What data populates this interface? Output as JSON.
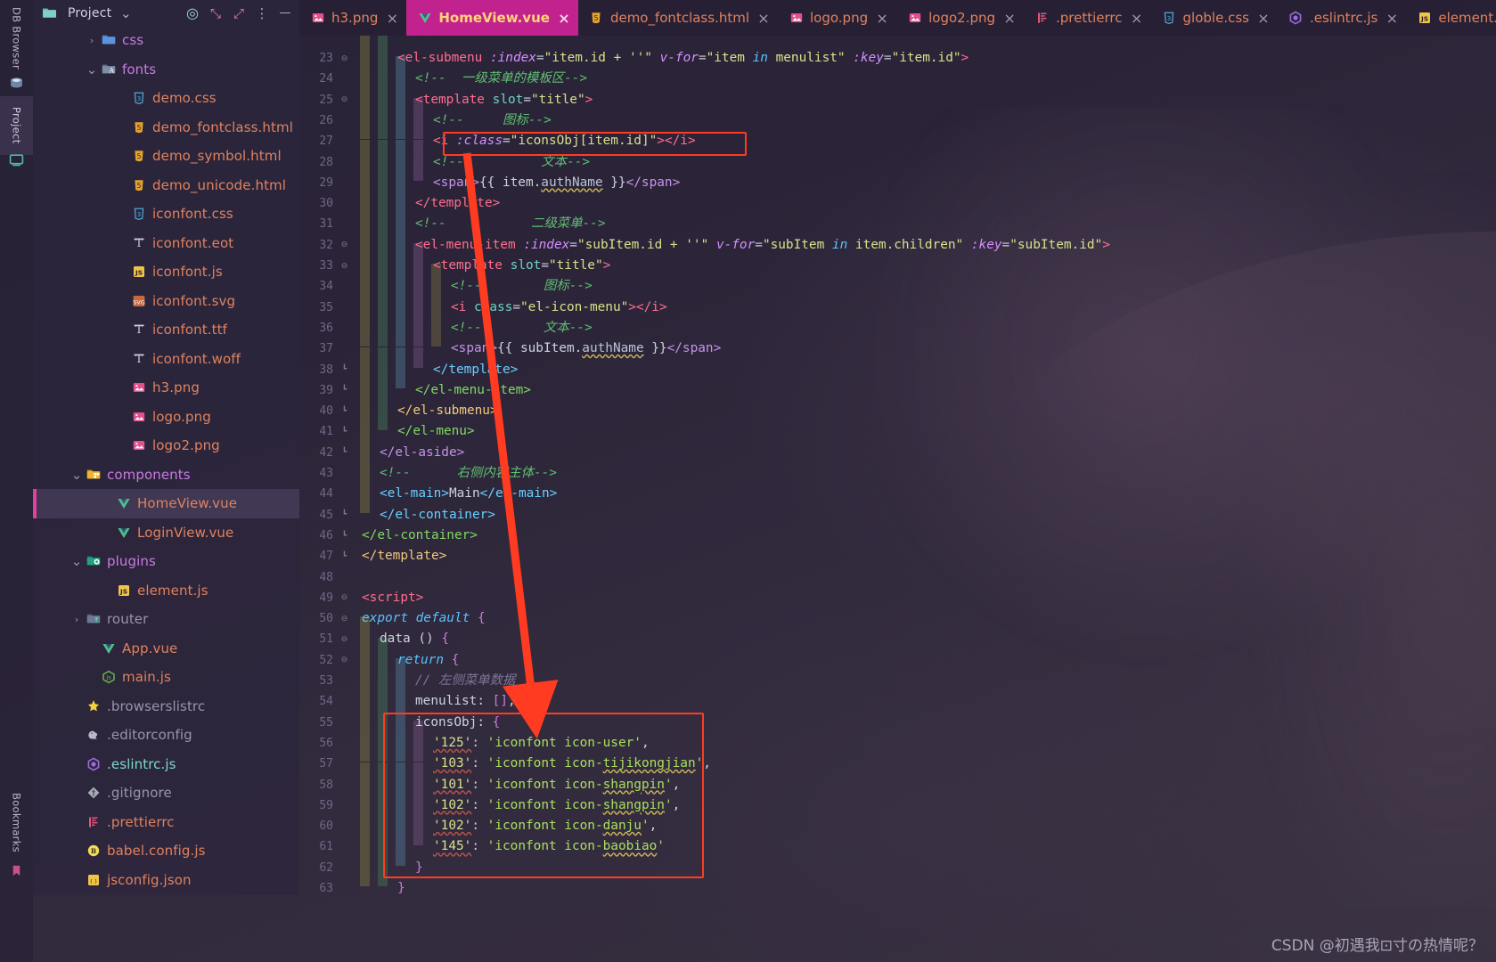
{
  "window": {
    "left_rail": [
      {
        "label": "DB Browser",
        "icon": "database-icon"
      },
      {
        "label": "Project",
        "icon": "project-icon"
      },
      {
        "label": "Bookmarks",
        "icon": "bookmark-icon"
      }
    ]
  },
  "project_pane": {
    "title": "Project",
    "header_buttons": [
      {
        "name": "chevron-down-icon",
        "glyph": "⌄"
      },
      {
        "name": "target-locate-icon",
        "glyph": "◎"
      },
      {
        "name": "expand-all-icon",
        "glyph": "⤡"
      },
      {
        "name": "collapse-all-icon",
        "glyph": "⤢"
      },
      {
        "name": "more-options-icon",
        "glyph": "⋮"
      },
      {
        "name": "minimize-icon",
        "glyph": "—"
      }
    ],
    "tree": [
      {
        "label": "css",
        "indent": 3,
        "chevron": "right",
        "icon": "folder-css",
        "color": "#c77ce0",
        "selected": false
      },
      {
        "label": "fonts",
        "indent": 3,
        "chevron": "down",
        "icon": "folder-fonts",
        "color": "#c77ce0",
        "selected": false
      },
      {
        "label": "demo.css",
        "indent": 5,
        "chevron": "",
        "icon": "css-file",
        "color": "#e0825f",
        "selected": false
      },
      {
        "label": "demo_fontclass.html",
        "indent": 5,
        "chevron": "",
        "icon": "html-file",
        "color": "#e0825f",
        "selected": false
      },
      {
        "label": "demo_symbol.html",
        "indent": 5,
        "chevron": "",
        "icon": "html-file",
        "color": "#e0825f",
        "selected": false
      },
      {
        "label": "demo_unicode.html",
        "indent": 5,
        "chevron": "",
        "icon": "html-file",
        "color": "#e0825f",
        "selected": false
      },
      {
        "label": "iconfont.css",
        "indent": 5,
        "chevron": "",
        "icon": "css-file",
        "color": "#e0825f",
        "selected": false
      },
      {
        "label": "iconfont.eot",
        "indent": 5,
        "chevron": "",
        "icon": "font-file",
        "color": "#e0825f",
        "selected": false
      },
      {
        "label": "iconfont.js",
        "indent": 5,
        "chevron": "",
        "icon": "js-file",
        "color": "#e0825f",
        "selected": false
      },
      {
        "label": "iconfont.svg",
        "indent": 5,
        "chevron": "",
        "icon": "svg-file",
        "color": "#e0825f",
        "selected": false
      },
      {
        "label": "iconfont.ttf",
        "indent": 5,
        "chevron": "",
        "icon": "font-file",
        "color": "#e0825f",
        "selected": false
      },
      {
        "label": "iconfont.woff",
        "indent": 5,
        "chevron": "",
        "icon": "font-file",
        "color": "#e0825f",
        "selected": false
      },
      {
        "label": "h3.png",
        "indent": 5,
        "chevron": "",
        "icon": "image-file",
        "color": "#e0825f",
        "selected": false
      },
      {
        "label": "logo.png",
        "indent": 5,
        "chevron": "",
        "icon": "image-file",
        "color": "#e0825f",
        "selected": false
      },
      {
        "label": "logo2.png",
        "indent": 5,
        "chevron": "",
        "icon": "image-file",
        "color": "#e0825f",
        "selected": false
      },
      {
        "label": "components",
        "indent": 2,
        "chevron": "down",
        "icon": "folder-components",
        "color": "#c77ce0",
        "selected": false
      },
      {
        "label": "HomeView.vue",
        "indent": 4,
        "chevron": "",
        "icon": "vue-file",
        "color": "#e0825f",
        "selected": true
      },
      {
        "label": "LoginView.vue",
        "indent": 4,
        "chevron": "",
        "icon": "vue-file",
        "color": "#e0825f",
        "selected": false
      },
      {
        "label": "plugins",
        "indent": 2,
        "chevron": "down",
        "icon": "folder-plugins",
        "color": "#c77ce0",
        "selected": false
      },
      {
        "label": "element.js",
        "indent": 4,
        "chevron": "",
        "icon": "js-file",
        "color": "#e0825f",
        "selected": false
      },
      {
        "label": "router",
        "indent": 2,
        "chevron": "right",
        "icon": "folder-router",
        "color": "#9b93ae",
        "selected": false
      },
      {
        "label": "App.vue",
        "indent": 3,
        "chevron": "",
        "icon": "vue-file",
        "color": "#e0825f",
        "selected": false
      },
      {
        "label": "main.js",
        "indent": 3,
        "chevron": "",
        "icon": "nodejs-file",
        "color": "#e0825f",
        "selected": false
      },
      {
        "label": ".browserslistrc",
        "indent": 2,
        "chevron": "",
        "icon": "browserslist-file",
        "color": "#9b93ae",
        "selected": false
      },
      {
        "label": ".editorconfig",
        "indent": 2,
        "chevron": "",
        "icon": "editorconfig-file",
        "color": "#9b93ae",
        "selected": false
      },
      {
        "label": ".eslintrc.js",
        "indent": 2,
        "chevron": "",
        "icon": "eslint-file",
        "color": "#7fd9c8",
        "selected": false
      },
      {
        "label": ".gitignore",
        "indent": 2,
        "chevron": "",
        "icon": "git-file",
        "color": "#9b93ae",
        "selected": false
      },
      {
        "label": ".prettierrc",
        "indent": 2,
        "chevron": "",
        "icon": "prettier-file",
        "color": "#e0825f",
        "selected": false
      },
      {
        "label": "babel.config.js",
        "indent": 2,
        "chevron": "",
        "icon": "babel-file",
        "color": "#e0825f",
        "selected": false
      },
      {
        "label": "jsconfig.json",
        "indent": 2,
        "chevron": "",
        "icon": "json-file",
        "color": "#e0825f",
        "selected": false
      }
    ]
  },
  "tabs": [
    {
      "label": "h3.png",
      "icon": "image-file",
      "active": false
    },
    {
      "label": "HomeView.vue",
      "icon": "vue-file",
      "active": true
    },
    {
      "label": "demo_fontclass.html",
      "icon": "html-file",
      "active": false
    },
    {
      "label": "logo.png",
      "icon": "image-file",
      "active": false
    },
    {
      "label": "logo2.png",
      "icon": "image-file",
      "active": false
    },
    {
      "label": ".prettierrc",
      "icon": "prettier-file",
      "active": false
    },
    {
      "label": "globle.css",
      "icon": "css-file",
      "active": false
    },
    {
      "label": ".eslintrc.js",
      "icon": "eslint-file",
      "active": false
    },
    {
      "label": "element.js",
      "icon": "js-file",
      "active": false
    }
  ],
  "editor": {
    "first_line_number": 23,
    "last_line_number": 63,
    "lines": [
      {
        "n": 23,
        "indent": 2,
        "fold": "fold",
        "html": "<span class='t-tag'>&lt;el-submenu</span> <span class='t-attr'>:index</span><span class='t-punc'>=</span><span class='t-str'>\"item.id + ''\"</span> <span class='t-attr'>v-for</span><span class='t-punc'>=</span><span class='t-str'>\"item </span><span class='t-kw'>in</span><span class='t-str'> menulist\"</span> <span class='t-attr'>:key</span><span class='t-punc'>=</span><span class='t-str'>\"item.id\"</span><span class='t-tag'>&gt;</span>"
      },
      {
        "n": 24,
        "indent": 3,
        "fold": "",
        "html": "<span class='t-cmt'>&lt;!--&nbsp;&nbsp;一级菜单的模板区--&gt;</span>"
      },
      {
        "n": 25,
        "indent": 3,
        "fold": "fold",
        "html": "<span class='t-tag'>&lt;template</span> <span class='t-attr2'>slot</span><span class='t-punc'>=</span><span class='t-str'>\"title\"</span><span class='t-tag'>&gt;</span>"
      },
      {
        "n": 26,
        "indent": 4,
        "fold": "",
        "html": "<span class='t-cmt'>&lt;!--&nbsp;&nbsp;&nbsp;&nbsp;&nbsp;图标--&gt;</span>"
      },
      {
        "n": 27,
        "indent": 4,
        "fold": "",
        "html": "<span class='t-tag'>&lt;i</span> <span class='t-attr'>:class</span><span class='t-punc'>=</span><span class='t-str'>\"iconsObj[item.id]\"</span><span class='t-tag'>&gt;</span><span class='t-tag'>&lt;/i&gt;</span>"
      },
      {
        "n": 28,
        "indent": 4,
        "fold": "",
        "html": "<span class='t-cmt'>&lt;!--&nbsp;&nbsp;&nbsp;&nbsp;&nbsp;&nbsp;&nbsp;&nbsp;&nbsp;&nbsp;文本--&gt;</span>"
      },
      {
        "n": 29,
        "indent": 4,
        "fold": "",
        "html": "<span class='t-tagp'>&lt;span&gt;</span><span class='t-mustache'>{{ item.</span><span class='t-field squig-y'>authName</span><span class='t-mustache'> }}</span><span class='t-tagp'>&lt;/span&gt;</span>"
      },
      {
        "n": 30,
        "indent": 3,
        "fold": "",
        "html": "<span class='t-tag'>&lt;/template&gt;</span>"
      },
      {
        "n": 31,
        "indent": 3,
        "fold": "",
        "html": "<span class='t-cmt'>&lt;!--&nbsp;&nbsp;&nbsp;&nbsp;&nbsp;&nbsp;&nbsp;&nbsp;&nbsp;&nbsp;&nbsp;二级菜单--&gt;</span>"
      },
      {
        "n": 32,
        "indent": 3,
        "fold": "fold",
        "html": "<span class='t-tag'>&lt;el-menu-item</span> <span class='t-attr'>:index</span><span class='t-punc'>=</span><span class='t-str'>\"subItem.id + ''\"</span> <span class='t-attr'>v-for</span><span class='t-punc'>=</span><span class='t-str'>\"subItem </span><span class='t-kw'>in</span><span class='t-str'> item.children\"</span> <span class='t-attr'>:key</span><span class='t-punc'>=</span><span class='t-str'>\"subItem.id\"</span><span class='t-tag'>&gt;</span>"
      },
      {
        "n": 33,
        "indent": 4,
        "fold": "fold",
        "html": "<span class='t-tag'>&lt;template</span> <span class='t-attr2'>slot</span><span class='t-punc'>=</span><span class='t-str'>\"title\"</span><span class='t-tag'>&gt;</span>"
      },
      {
        "n": 34,
        "indent": 5,
        "fold": "",
        "html": "<span class='t-cmt'>&lt;!--&nbsp;&nbsp;&nbsp;&nbsp;&nbsp;&nbsp;&nbsp;&nbsp;图标--&gt;</span>"
      },
      {
        "n": 35,
        "indent": 5,
        "fold": "",
        "html": "<span class='t-tag'>&lt;i</span> <span class='t-attr2'>class</span><span class='t-punc'>=</span><span class='t-str'>\"el-icon-menu\"</span><span class='t-tag'>&gt;</span><span class='t-tag'>&lt;/i&gt;</span>"
      },
      {
        "n": 36,
        "indent": 5,
        "fold": "",
        "html": "<span class='t-cmt'>&lt;!--&nbsp;&nbsp;&nbsp;&nbsp;&nbsp;&nbsp;&nbsp;&nbsp;文本--&gt;</span>"
      },
      {
        "n": 37,
        "indent": 5,
        "fold": "",
        "html": "<span class='t-tagp'>&lt;span&gt;</span><span class='t-mustache'>{{ subItem.</span><span class='t-field squig-y'>authName</span><span class='t-mustache'> }}</span><span class='t-tagp'>&lt;/span&gt;</span>"
      },
      {
        "n": 38,
        "indent": 4,
        "fold": "fend",
        "html": "<span class='t-tag2'>&lt;/template&gt;</span>"
      },
      {
        "n": 39,
        "indent": 3,
        "fold": "fend",
        "html": "<span class='t-tagg'>&lt;/el-menu-item&gt;</span>"
      },
      {
        "n": 40,
        "indent": 2,
        "fold": "fend",
        "html": "<span class='t-tagy'>&lt;/el-submenu&gt;</span>"
      },
      {
        "n": 41,
        "indent": 2,
        "fold": "fend",
        "html": "<span class='t-tagg'>&lt;/el-menu&gt;</span>"
      },
      {
        "n": 42,
        "indent": 1,
        "fold": "fend",
        "html": "<span class='t-tagp'>&lt;/el-aside&gt;</span>"
      },
      {
        "n": 43,
        "indent": 1,
        "fold": "",
        "html": "<span class='t-cmt'>&lt;!--&nbsp;&nbsp;&nbsp;&nbsp;&nbsp;&nbsp;右侧内容主体--&gt;</span>"
      },
      {
        "n": 44,
        "indent": 1,
        "fold": "",
        "html": "<span class='t-tag2'>&lt;el-main&gt;</span><span class='t-plain'>Main</span><span class='t-tag2'>&lt;/el-main&gt;</span>"
      },
      {
        "n": 45,
        "indent": 1,
        "fold": "fend",
        "html": "<span class='t-tag2'>&lt;/el-container&gt;</span>"
      },
      {
        "n": 46,
        "indent": 0,
        "fold": "fend",
        "html": "<span class='t-tagg'>&lt;/el-container&gt;</span>"
      },
      {
        "n": 47,
        "indent": 0,
        "fold": "fend",
        "html": "<span class='t-tagy'>&lt;/template&gt;</span>"
      },
      {
        "n": 48,
        "indent": 0,
        "fold": "",
        "html": ""
      },
      {
        "n": 49,
        "indent": 0,
        "fold": "fold",
        "html": "<span class='t-tag'>&lt;script&gt;</span>"
      },
      {
        "n": 50,
        "indent": 0,
        "fold": "fold",
        "html": "<span class='t-kw'>export default</span> <span class='t-brk'>{</span>"
      },
      {
        "n": 51,
        "indent": 1,
        "fold": "fold",
        "html": "<span class='t-plain'>data</span> <span class='t-punc'>()</span> <span class='t-brk'>{</span>"
      },
      {
        "n": 52,
        "indent": 2,
        "fold": "fold",
        "html": "<span class='t-kw'>return</span> <span class='t-brk'>{</span>"
      },
      {
        "n": 53,
        "indent": 3,
        "fold": "",
        "html": "<span class='t-cmt2'>// 左侧菜单数据</span>"
      },
      {
        "n": 54,
        "indent": 3,
        "fold": "",
        "html": "<span class='t-plain'>menulist</span><span class='t-punc'>:</span> <span class='t-brk'>[]</span><span class='t-punc'>,</span>"
      },
      {
        "n": 55,
        "indent": 3,
        "fold": "",
        "html": "<span class='t-plain'>iconsObj</span><span class='t-punc'>:</span> <span class='t-brk'>{</span>"
      },
      {
        "n": 56,
        "indent": 4,
        "fold": "",
        "html": "<span class='t-str squig'>'125'</span><span class='t-punc'>:</span> <span class='t-prop'>'iconfont icon-user'</span><span class='t-punc'>,</span>"
      },
      {
        "n": 57,
        "indent": 4,
        "fold": "",
        "html": "<span class='t-str squig'>'103'</span><span class='t-punc'>:</span> <span class='t-prop'>'iconfont icon-</span><span class='t-prop squig-y'>tijikongjian</span><span class='t-prop'>'</span><span class='t-punc'>,</span>"
      },
      {
        "n": 58,
        "indent": 4,
        "fold": "",
        "html": "<span class='t-str squig'>'101'</span><span class='t-punc'>:</span> <span class='t-prop'>'iconfont icon-</span><span class='t-prop squig-y'>shangpin</span><span class='t-prop'>'</span><span class='t-punc'>,</span>"
      },
      {
        "n": 59,
        "indent": 4,
        "fold": "",
        "html": "<span class='t-str squig'>'102'</span><span class='t-punc'>:</span> <span class='t-prop'>'iconfont icon-</span><span class='t-prop squig-y'>shangpin</span><span class='t-prop'>'</span><span class='t-punc'>,</span>"
      },
      {
        "n": 60,
        "indent": 4,
        "fold": "",
        "html": "<span class='t-str squig'>'102'</span><span class='t-punc'>:</span> <span class='t-prop'>'iconfont icon-</span><span class='t-prop squig-y'>danju</span><span class='t-prop'>'</span><span class='t-punc'>,</span>"
      },
      {
        "n": 61,
        "indent": 4,
        "fold": "",
        "html": "<span class='t-str squig'>'145'</span><span class='t-punc'>:</span> <span class='t-prop'>'iconfont icon-</span><span class='t-prop squig-y'>baobiao</span><span class='t-prop'>'</span>"
      },
      {
        "n": 62,
        "indent": 3,
        "fold": "",
        "html": "<span class='t-brk'>}</span>"
      },
      {
        "n": 63,
        "indent": 2,
        "fold": "",
        "html": "<span class='t-brk'>}</span>"
      }
    ]
  },
  "annotations": {
    "box_top_label": "<i :class=\"iconsObj[item.id]\"></i>",
    "box_bottom_label": "iconsObj: { ... }",
    "arrow_color": "#ff3b21"
  },
  "watermark": "CSDN @初遇我⊡寸の热情呢？"
}
